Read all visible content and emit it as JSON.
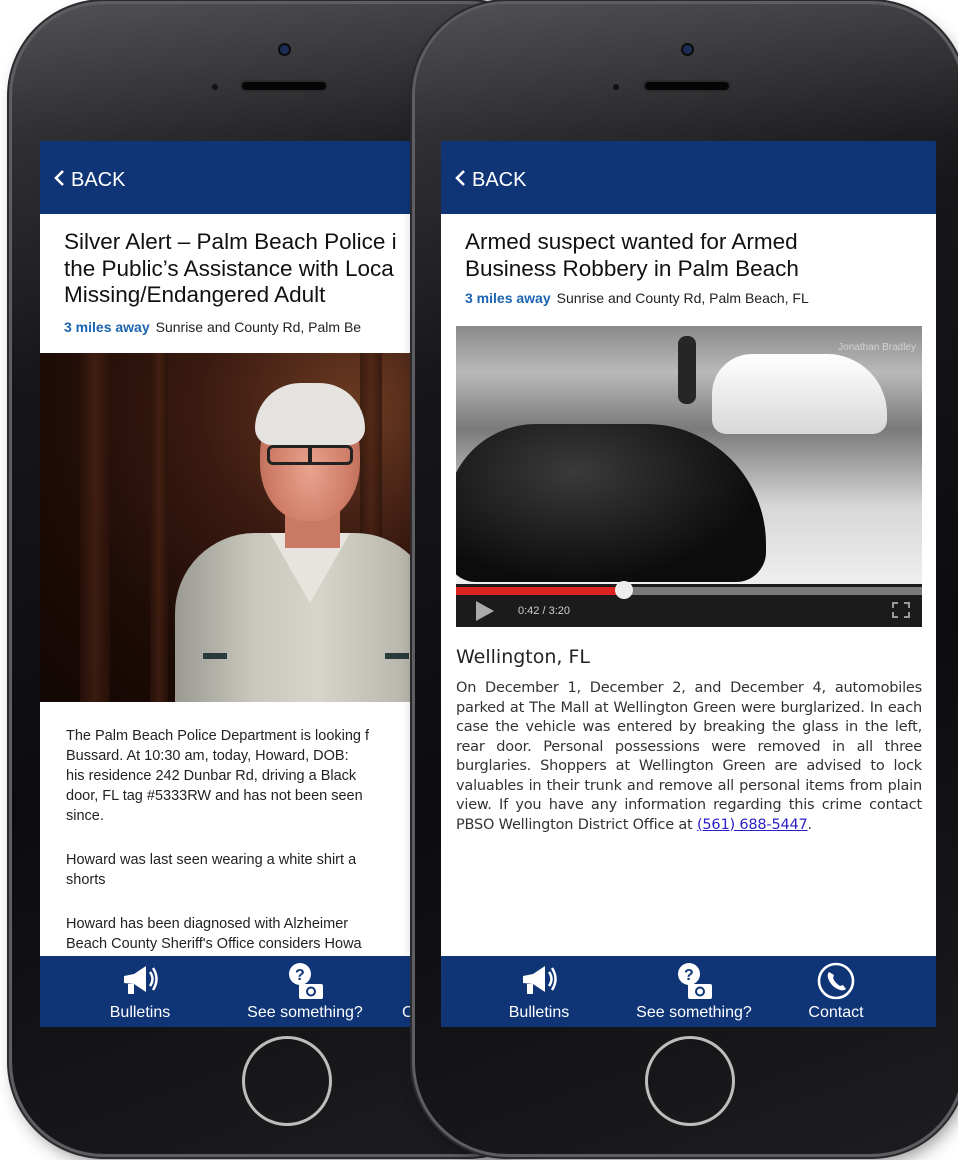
{
  "left_phone": {
    "nav": {
      "back_label": "BACK"
    },
    "article": {
      "title_lines": [
        "Silver Alert – Palm Beach Police i",
        "the Public’s Assistance with Loca",
        "Missing/Endangered Adult"
      ],
      "distance": "3 miles away",
      "location": "Sunrise and County Rd, Palm Be",
      "paragraph1": [
        "The Palm Beach Police Department is looking f",
        "Bussard.  At 10:30 am, today, Howard,  DOB: ",
        "his residence 242 Dunbar Rd, driving a Black ",
        "door, FL tag #5333RW and has not been seen ",
        "since."
      ],
      "paragraph2": [
        "Howard was last seen wearing a white shirt a",
        "shorts"
      ],
      "paragraph3": [
        "Howard has been diagnosed with Alzheimer",
        "Beach County Sheriff's Office considers Howa"
      ]
    },
    "tabs": [
      {
        "label": "Bulletins",
        "icon": "megaphone-icon"
      },
      {
        "label": "See something?",
        "icon": "camera-question-icon"
      },
      {
        "label": "C",
        "icon": "contact-icon"
      }
    ]
  },
  "right_phone": {
    "nav": {
      "back_label": "BACK"
    },
    "article": {
      "title_lines": [
        "Armed suspect wanted for Armed",
        "Business Robbery in Palm Beach"
      ],
      "distance": "3 miles away",
      "location": "Sunrise and County Rd, Palm Beach, FL",
      "video": {
        "timecode": "0:42 / 3:20",
        "progress": 0.36,
        "watermark": "Jonathan Bradley"
      },
      "city": "Wellington, FL",
      "body": "On December 1, December 2, and December 4, automobiles parked at The Mall at Wellington Green were burglarized. In each case the vehicle was entered by breaking the glass in the left, rear door. Personal possessions were removed in all three burglaries. Shoppers at Wellington Green are advised to lock valuables in their trunk and remove all personal items from plain view. If you have any information regarding this crime contact PBSO Wellington District Office at ",
      "phone_link": "(561) 688-5447",
      "body_end": "."
    },
    "tabs": [
      {
        "label": "Bulletins",
        "icon": "megaphone-icon"
      },
      {
        "label": "See something?",
        "icon": "camera-question-icon"
      },
      {
        "label": "Contact",
        "icon": "phone-icon"
      }
    ]
  },
  "colors": {
    "navbar": "#0f3577",
    "distance": "#1b64b1",
    "link": "#2a1ec8",
    "progress": "#dd2222"
  }
}
